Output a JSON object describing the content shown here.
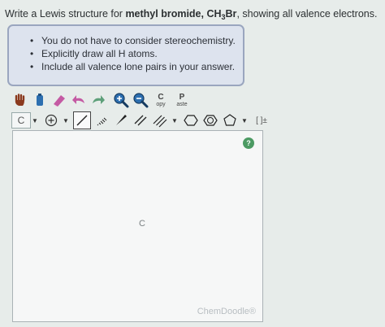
{
  "question": {
    "prefix": "Write a Lewis structure for ",
    "compound": "methyl bromide, CH",
    "subscript": "3",
    "compound_tail": "Br",
    "suffix": ", showing all valence electrons."
  },
  "hints": [
    "You do not have to consider stereochemistry.",
    "Explicitly draw all H atoms.",
    "Include all valence lone pairs in your answer."
  ],
  "toolbar": {
    "copy_big": "C",
    "copy_small": "opy",
    "paste_big": "P",
    "paste_small": "aste",
    "element": "C",
    "charge_label": "[ ]±",
    "dropdown": "▼"
  },
  "canvas": {
    "atom_label": "C",
    "brand": "ChemDoodle®",
    "help": "?"
  },
  "colors": {
    "background": "#e7ecea",
    "hint_fill": "#dde3ee",
    "hint_border": "#9aa6bf",
    "help_green": "#4c9a63"
  }
}
